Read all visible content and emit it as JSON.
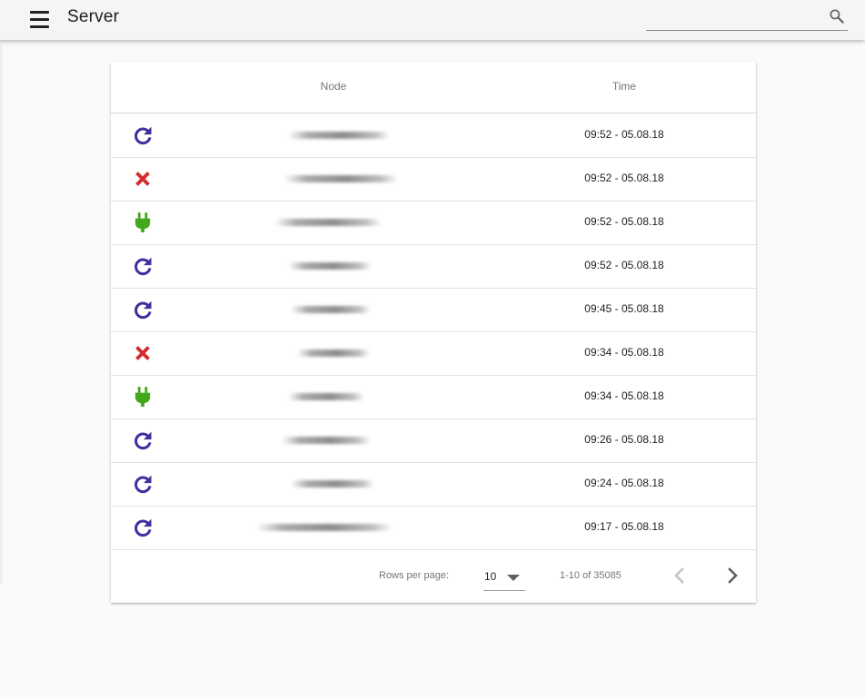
{
  "appbar": {
    "title": "Server",
    "search": {
      "value": "",
      "placeholder": ""
    }
  },
  "table": {
    "columns": {
      "node": "Node",
      "time": "Time"
    },
    "rows": [
      {
        "status": "restart-icon",
        "node": "",
        "time": "09:52 - 05.08.18"
      },
      {
        "status": "error-icon",
        "node": "",
        "time": "09:52 - 05.08.18"
      },
      {
        "status": "connect-icon",
        "node": "",
        "time": "09:52 - 05.08.18"
      },
      {
        "status": "restart-icon",
        "node": "",
        "time": "09:52 - 05.08.18"
      },
      {
        "status": "restart-icon",
        "node": "",
        "time": "09:45 - 05.08.18"
      },
      {
        "status": "error-icon",
        "node": "",
        "time": "09:34 - 05.08.18"
      },
      {
        "status": "connect-icon",
        "node": "",
        "time": "09:34 - 05.08.18"
      },
      {
        "status": "restart-icon",
        "node": "",
        "time": "09:26 - 05.08.18"
      },
      {
        "status": "restart-icon",
        "node": "",
        "time": "09:24 - 05.08.18"
      },
      {
        "status": "restart-icon",
        "node": "",
        "time": "09:17 - 05.08.18"
      }
    ]
  },
  "pagination": {
    "rows_per_page_label": "Rows per page:",
    "rows_per_page_value": "10",
    "range_text": "1-10 of 35085"
  },
  "colors": {
    "restart": "#3f2fa0",
    "error": "#d32f2f",
    "connect": "#43a81e"
  }
}
